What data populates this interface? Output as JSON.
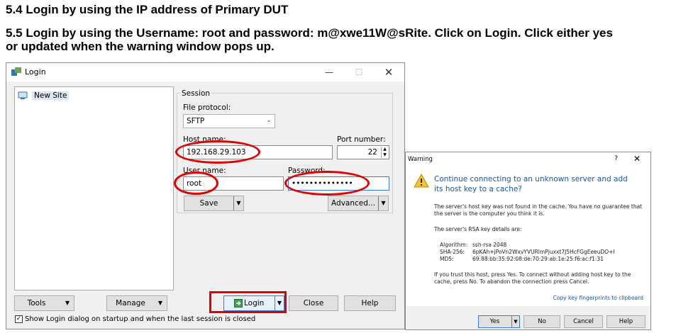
{
  "doc": {
    "step_54": "5.4 Login by using the IP address of Primary DUT",
    "step_55_line1": "5.5 Login by using the Username: root and password: m@xwe11W@sRite. Click on Login. Click either yes",
    "step_55_line2": "or updated when the warning window pops up."
  },
  "login": {
    "title": "Login",
    "tree": {
      "new_site": "New Site"
    },
    "session": {
      "group_label": "Session",
      "file_protocol_label": "File protocol:",
      "file_protocol_value": "SFTP",
      "host_name_label": "Host name:",
      "host_name_value": "192.168.29.103",
      "port_label": "Port number:",
      "port_value": "22",
      "user_name_label": "User name:",
      "user_name_value": "root",
      "password_label": "Password:",
      "password_value": "••••••••••••••",
      "save_label": "Save",
      "advanced_label": "Advanced..."
    },
    "buttons": {
      "tools": "Tools",
      "manage": "Manage",
      "login": "Login",
      "close": "Close",
      "help": "Help"
    },
    "show_login_checkbox": "Show Login dialog on startup and when the last session is closed",
    "highlight_color": "#e10000"
  },
  "warning": {
    "title": "Warning",
    "help_glyph": "?",
    "heading": "Continue connecting to an unknown server and add its host key to a cache?",
    "p1": "The server's host key was not found in the cache. You have no guarantee that the server is the computer you think it is.",
    "p2": "The server's RSA key details are:",
    "algorithm_label": "Algorithm:",
    "algorithm_value": "ssh-rsa 2048",
    "sha_label": "SHA-256:",
    "sha_value": "6pKAh+jPoVn2WxvYVURlmPjuxxt7J5HcFGgEeeuDO+I",
    "md5_label": "MD5:",
    "md5_value": "69:88:bb:35:92:08:de:70:29:ab:1e:25:f6:ac:f1:31",
    "p3": "If you trust this host, press Yes. To connect without adding host key to the cache, press No. To abandon the connection press Cancel.",
    "copy_link": "Copy key fingerprints to clipboard",
    "buttons": {
      "yes": "Yes",
      "no": "No",
      "cancel": "Cancel",
      "help": "Help"
    },
    "heading_color": "#1a56a6"
  }
}
